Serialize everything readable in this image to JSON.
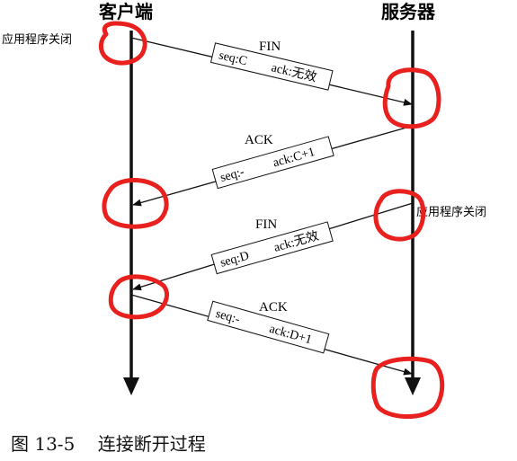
{
  "actors": {
    "client": "客户端",
    "server": "服务器"
  },
  "side_labels": {
    "client_close": "应用程序关闭",
    "server_close": "应用程序关闭"
  },
  "messages": [
    {
      "type": "FIN",
      "seq": "seq:C",
      "ack": "ack:无效"
    },
    {
      "type": "ACK",
      "seq": "seq:-",
      "ack": "ack:C+1"
    },
    {
      "type": "FIN",
      "seq": "seq:D",
      "ack": "ack:无效"
    },
    {
      "type": "ACK",
      "seq": "seq:-",
      "ack": "ack:D+1"
    }
  ],
  "caption": {
    "number": "图 13-5",
    "title": "连接断开过程"
  },
  "colors": {
    "line": "#111111",
    "highlight": "#e8201e"
  }
}
